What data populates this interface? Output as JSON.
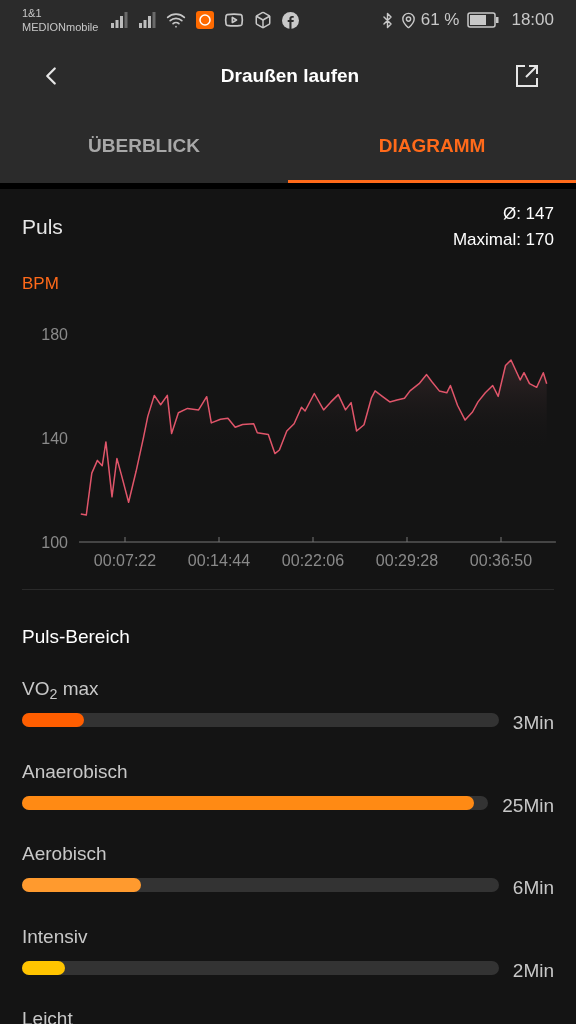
{
  "status_bar": {
    "carrier_top": "1&1",
    "carrier_bottom": "MEDIONmobile",
    "battery": "61 %",
    "time": "18:00"
  },
  "header": {
    "title": "Draußen laufen"
  },
  "tabs": [
    {
      "label": "ÜBERBLICK",
      "selected": false
    },
    {
      "label": "DIAGRAMM",
      "selected": true
    }
  ],
  "pulse": {
    "title": "Puls",
    "average": "Ø: 147",
    "maximum": "Maximal: 170",
    "chart_data": {
      "type": "area",
      "ylabel": "BPM",
      "xlim": [
        226,
        2468
      ],
      "ylim": [
        100,
        180
      ],
      "yticks": [
        100,
        140,
        180
      ],
      "xticks": [
        {
          "value": 442,
          "label": "00:07:22"
        },
        {
          "value": 884,
          "label": "00:14:44"
        },
        {
          "value": 1326,
          "label": "00:22:06"
        },
        {
          "value": 1768,
          "label": "00:29:28"
        },
        {
          "value": 2210,
          "label": "00:36:50"
        }
      ],
      "x": [
        234,
        260,
        286,
        312,
        335,
        352,
        381,
        404,
        425,
        459,
        494,
        528,
        549,
        580,
        610,
        641,
        661,
        693,
        736,
        788,
        826,
        848,
        891,
        926,
        960,
        995,
        1047,
        1064,
        1116,
        1147,
        1168,
        1203,
        1237,
        1272,
        1289,
        1332,
        1376,
        1410,
        1445,
        1479,
        1505,
        1531,
        1566,
        1600,
        1618,
        1652,
        1687,
        1721,
        1756,
        1782,
        1825,
        1860,
        1885,
        1920,
        1955,
        1972,
        2006,
        2041,
        2076,
        2102,
        2136,
        2171,
        2197,
        2231,
        2257,
        2300,
        2318,
        2344,
        2378,
        2409,
        2425
      ],
      "series": [
        {
          "color": "#e0556a",
          "values": [
            110.8,
            110.4,
            126.5,
            131.4,
            129.3,
            138.5,
            117.4,
            132.1,
            125.8,
            115.3,
            127.2,
            139.9,
            148.3,
            156.4,
            152.8,
            156.4,
            141.7,
            149.7,
            151.4,
            150.8,
            155.9,
            145.8,
            147.2,
            147.6,
            144.1,
            145.2,
            145.5,
            142,
            141.3,
            134,
            135.4,
            142.7,
            145.5,
            151.8,
            150.4,
            157.1,
            150.8,
            153.9,
            156.7,
            150.8,
            153.6,
            142.7,
            145.1,
            155.3,
            158.1,
            156,
            153.9,
            154.6,
            155.3,
            158.1,
            160.9,
            164.4,
            161.6,
            158.1,
            157.4,
            160.2,
            152.5,
            146.9,
            150,
            153.9,
            157.4,
            160.2,
            156,
            167.9,
            170,
            162.3,
            165.1,
            160.9,
            159.5,
            165.1,
            160.9
          ]
        }
      ]
    }
  },
  "zones": {
    "title": "Puls-Bereich",
    "items": [
      {
        "label": "VO$_{2}$ max",
        "level": 0.13,
        "duration": "3Min",
        "color": "#ff5e00"
      },
      {
        "label": "Anaerobisch",
        "level": 0.97,
        "duration": "25Min",
        "color": "#ff8a14"
      },
      {
        "label": "Aerobisch",
        "level": 0.25,
        "duration": "6Min",
        "color": "#ff9a2e"
      },
      {
        "label": "Intensiv",
        "level": 0.09,
        "duration": "2Min",
        "color": "#ffc400"
      },
      {
        "label": "Leicht"
      }
    ]
  }
}
